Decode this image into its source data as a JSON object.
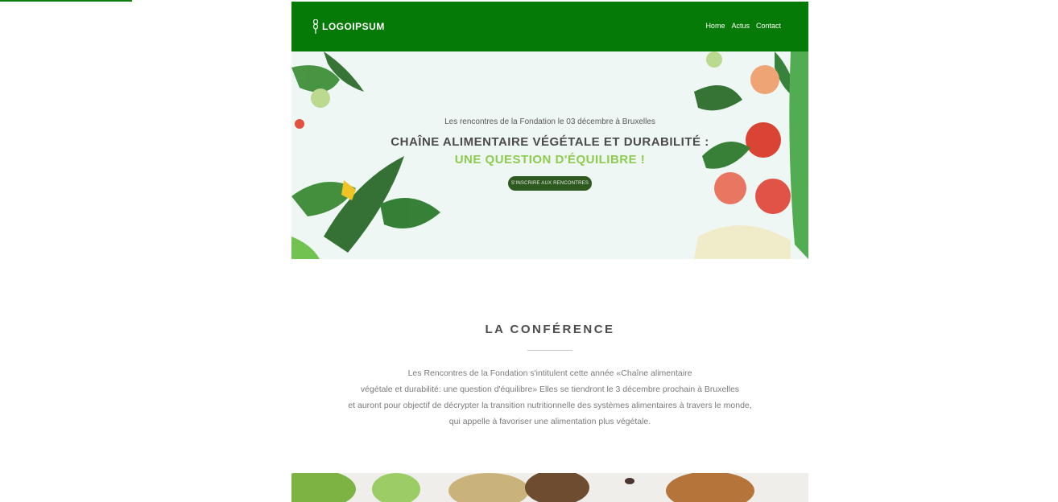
{
  "header": {
    "logo_text": "LOGOIPSUM",
    "nav": [
      "Home",
      "Actus",
      "Contact"
    ]
  },
  "hero": {
    "kicker": "Les rencontres de la Fondation le 03 décembre à Bruxelles",
    "title_line1": "CHAÎNE ALIMENTAIRE VÉGÉTALE ET DURABILITÉ :",
    "title_line2": "UNE QUESTION D'ÉQUILIBRE !",
    "cta_label": "S'INSCRIRE AUX RENCONTRES"
  },
  "conference": {
    "title": "LA CONFÉRENCE",
    "lines": [
      "Les Rencontres de la Fondation   s'intitulent cette année «Chaîne alimentaire",
      "végétale et durabilité: une question d'équilibre» Elles se tiendront le 3 décembre prochain à Bruxelles",
      "et auront pour objectif de décrypter la transition nutritionnelle des systèmes alimentaires à travers le monde,",
      "qui appelle à favoriser une alimentation plus végétale."
    ]
  },
  "colors": {
    "brand_green": "#067a06",
    "accent_light_green": "#8dcc4e",
    "cta_dark_green": "#2d5a1f",
    "hero_bg": "#eef7f4"
  },
  "icons": {
    "logo": "wheat-icon"
  }
}
